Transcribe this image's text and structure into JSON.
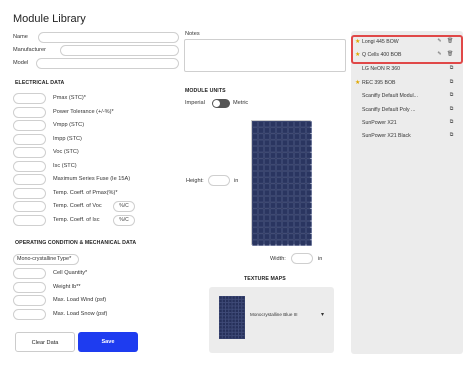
{
  "page": {
    "title": "Module Library"
  },
  "header_fields": {
    "name_label": "Name",
    "manufacturer_label": "Manufacturer",
    "model_label": "Model",
    "notes_label": "Notes"
  },
  "electrical": {
    "title": "ELECTRICAL DATA",
    "rows": [
      {
        "label": "Pmax (STC)*"
      },
      {
        "label": "Power Tolerance (+/-%)*"
      },
      {
        "label": "Vmpp (STC)"
      },
      {
        "label": "Impp (STC)"
      },
      {
        "label": "Voc (STC)"
      },
      {
        "label": "Isc (STC)"
      },
      {
        "label": "Maximum Series Fuse (Ie 15A)"
      },
      {
        "label": "Temp. Coeff. of Pmax(%)*"
      },
      {
        "label": "Temp. Coeff. of Voc",
        "unit": "%/C"
      },
      {
        "label": "Temp. Coeff. of Isc",
        "unit": "%/C"
      }
    ]
  },
  "operating": {
    "title": "OPERATING CONDITION & MECHANICAL DATA",
    "type_value": "Mono-crystalline",
    "type_label": "Type*",
    "rows": [
      {
        "label": "Cell Quantity*"
      },
      {
        "label": "Weight  lb**"
      },
      {
        "label": "Max. Load Wind (psf)"
      },
      {
        "label": "Max. Load Snow (psf)"
      }
    ]
  },
  "units": {
    "title": "MODULE UNITS",
    "imperial": "Imperial",
    "metric": "Metric",
    "height_label": "Height:",
    "height_unit": "in",
    "width_label": "Width:",
    "width_unit": "in"
  },
  "texture": {
    "title": "TEXTURE MAPS",
    "selected": "Monocrystalline Blue III"
  },
  "buttons": {
    "clear": "Clear Data",
    "save": "Save"
  },
  "library": {
    "items": [
      {
        "label": "Longi 445 BOW",
        "favorite": true,
        "highlighted": true,
        "editable": true
      },
      {
        "label": "Q Cells 400 BOB",
        "favorite": true,
        "highlighted": true,
        "editable": true
      },
      {
        "label": "LG NeON R 360"
      },
      {
        "label": "REC 395 BOB",
        "favorite": true,
        "editable": false
      },
      {
        "label": "Scanifly Default Modul..."
      },
      {
        "label": "Scanifly Default Poly ..."
      },
      {
        "label": "SunPower X21"
      },
      {
        "label": "SunPower X21 Black"
      }
    ]
  },
  "colors": {
    "accent": "#1e3cf0",
    "highlight": "#e04848",
    "star": "#e0a800"
  }
}
